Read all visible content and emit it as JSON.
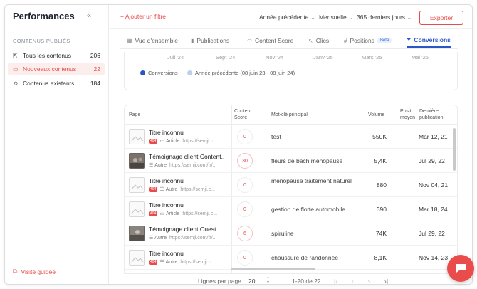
{
  "sidebar": {
    "title": "Performances",
    "collapse_icon": "double-chevron-left-icon",
    "section_label": "CONTENUS PUBLIÉS",
    "items": [
      {
        "label": "Tous les contenus",
        "count": "206",
        "icon": "external-link-icon"
      },
      {
        "label": "Nouveaux contenus",
        "count": "22",
        "icon": "new-file-icon",
        "active": true
      },
      {
        "label": "Contenus existants",
        "count": "184",
        "icon": "refresh-icon"
      }
    ],
    "guided_tour": "Visite guidée"
  },
  "toolbar": {
    "add_filter": "+ Ajouter un filtre",
    "comparison": "Année précédente",
    "granularity": "Mensuelle",
    "period": "365 derniers jours",
    "export": "Exporter"
  },
  "tabs": [
    {
      "label": "Vue d'ensemble",
      "icon": "grid-icon"
    },
    {
      "label": "Publications",
      "icon": "bar-chart-icon"
    },
    {
      "label": "Content Score",
      "icon": "gauge-icon"
    },
    {
      "label": "Clics",
      "icon": "cursor-icon"
    },
    {
      "label": "Positions",
      "icon": "hash-icon",
      "badge": "Béta"
    },
    {
      "label": "Conversions",
      "icon": "funnel-icon",
      "active": true
    }
  ],
  "chart": {
    "x_ticks": [
      "Juil '24",
      "Sept '24",
      "Nov '24",
      "Janv '25",
      "Mars '25",
      "Mai '25"
    ],
    "legend": [
      {
        "label": "Conversions",
        "color": "#2a56c6"
      },
      {
        "label": "Année précédente (08 juin 23 - 08 juin 24)",
        "color": "#b9d0ee"
      }
    ]
  },
  "table": {
    "headers": {
      "page": "Page",
      "content_score": "Content Score",
      "keyword": "Mot-clé principal",
      "volume": "Volume",
      "position": "Positi moyen",
      "published": "Dernière publication"
    },
    "rows": [
      {
        "title": "Titre inconnu",
        "badge": "404",
        "kind": "Article",
        "url": "https://semji.c...",
        "score": "0",
        "keyword": "test",
        "volume": "550K",
        "position": "",
        "date": "Mar 12, 21",
        "photo": false
      },
      {
        "title": "Témoignage client Content...",
        "badge": "",
        "kind": "Autre",
        "url": "https://semji.com/fr/...",
        "score": "30",
        "keyword": "fleurs de bach ménopause",
        "volume": "5,4K",
        "position": "",
        "date": "Jul 29, 22",
        "photo": true
      },
      {
        "title": "Titre inconnu",
        "badge": "404",
        "kind": "Autre",
        "url": "https://semji.c...",
        "score": "0",
        "keyword": "menopause traitement naturel",
        "volume": "880",
        "position": "",
        "date": "Nov 04, 21",
        "photo": false
      },
      {
        "title": "Titre inconnu",
        "badge": "404",
        "kind": "Article",
        "url": "https://semji.c...",
        "score": "0",
        "keyword": "gestion de flotte automobile",
        "volume": "390",
        "position": "",
        "date": "Mar 18, 24",
        "photo": false
      },
      {
        "title": "Témoignage client Ouest...",
        "badge": "",
        "kind": "Autre",
        "url": "https://semji.com/fr/...",
        "score": "6",
        "keyword": "spiruline",
        "volume": "74K",
        "position": "",
        "date": "Jul 29, 22",
        "photo": true
      },
      {
        "title": "Titre inconnu",
        "badge": "404",
        "kind": "Autre",
        "url": "https://semji.c...",
        "score": "0",
        "keyword": "chaussure de randonnée",
        "volume": "8,1K",
        "position": "",
        "date": "Nov 14, 23",
        "photo": false
      }
    ]
  },
  "pagination": {
    "rows_per_page_label": "Lignes par page",
    "rows_per_page": "20",
    "range": "1-20 de 22"
  },
  "colors": {
    "accent": "#e84b4b",
    "primary": "#2a56c6"
  }
}
